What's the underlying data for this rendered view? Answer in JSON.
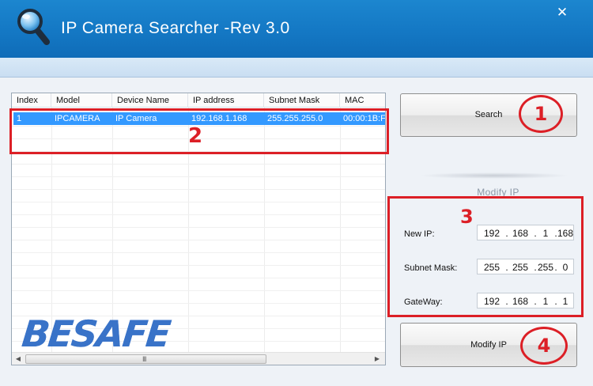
{
  "window": {
    "title": "IP Camera Searcher -Rev 3.0",
    "close_glyph": "✕",
    "app_icon": "magnifier-icon"
  },
  "device_list": {
    "columns": [
      "Index",
      "Model",
      "Device Name",
      "IP address",
      "Subnet Mask",
      "MAC"
    ],
    "rows": [
      {
        "index": "1",
        "model": "IPCAMERA",
        "device_name": "IP Camera",
        "ip_address": "192.168.1.168",
        "subnet_mask": "255.255.255.0",
        "mac": "00:00:1B:F"
      }
    ],
    "scrollbar_grip": "III"
  },
  "buttons": {
    "search_label": "Search",
    "modify_label": "Modify IP"
  },
  "modify_ip": {
    "section_title": "Modify IP",
    "fields": [
      {
        "label": "New IP:",
        "octets": [
          "192",
          "168",
          "1",
          "168"
        ]
      },
      {
        "label": "Subnet Mask:",
        "octets": [
          "255",
          "255",
          "255",
          "0"
        ]
      },
      {
        "label": "GateWay:",
        "octets": [
          "192",
          "168",
          "1",
          "1"
        ]
      }
    ]
  },
  "annotations": {
    "step1": "1",
    "step2": "2",
    "step3": "3",
    "step4": "4",
    "color": "#dc1f26"
  },
  "watermark": {
    "text": "BESAFE",
    "color": "#2f6cc6"
  },
  "colors": {
    "titlebar": "#1478c4",
    "selection": "#3399ff"
  }
}
